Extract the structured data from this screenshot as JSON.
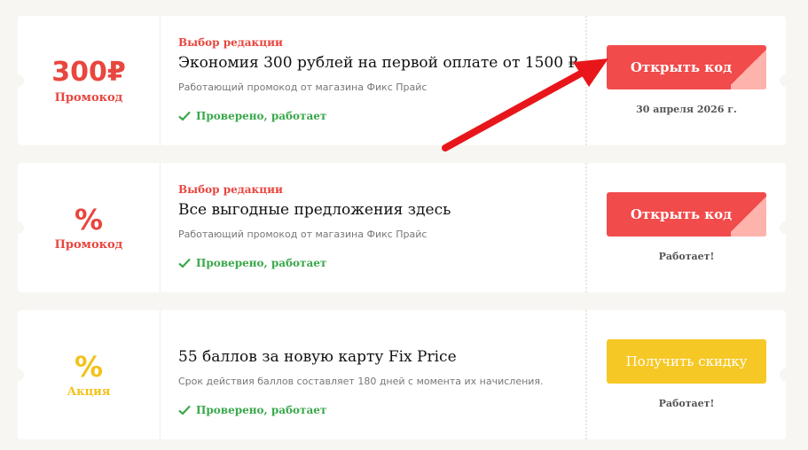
{
  "coupons": [
    {
      "amount": "300₽",
      "kind": "Промокод",
      "editor_label": "Выбор редакции",
      "title": "Экономия 300 рублей на первой оплате от 1500 ₽",
      "description": "Работающий промокод от магазина Фикс Прайс",
      "verified": "Проверено, работает",
      "button_label": "Открыть код",
      "note": "30 апреля 2026 г."
    },
    {
      "amount": "%",
      "kind": "Промокод",
      "editor_label": "Выбор редакции",
      "title": "Все выгодные предложения здесь",
      "description": "Работающий промокод от магазина Фикс Прайс",
      "verified": "Проверено, работает",
      "button_label": "Открыть код",
      "note": "Работает!"
    },
    {
      "amount": "%",
      "kind": "Акция",
      "editor_label": "",
      "title": "55 баллов за новую карту Fix Price",
      "description": "Срок действия баллов составляет 180 дней с момента их начисления.",
      "verified": "Проверено, работает",
      "button_label": "Получить скидку",
      "note": "Работает!"
    }
  ],
  "colors": {
    "accent_red": "#f14b4b",
    "accent_yellow": "#f6c825",
    "verified_green": "#3aa84b",
    "arrow_red": "#e8161b"
  },
  "icons": {
    "verified": "check-icon",
    "annotation": "arrow-icon"
  }
}
